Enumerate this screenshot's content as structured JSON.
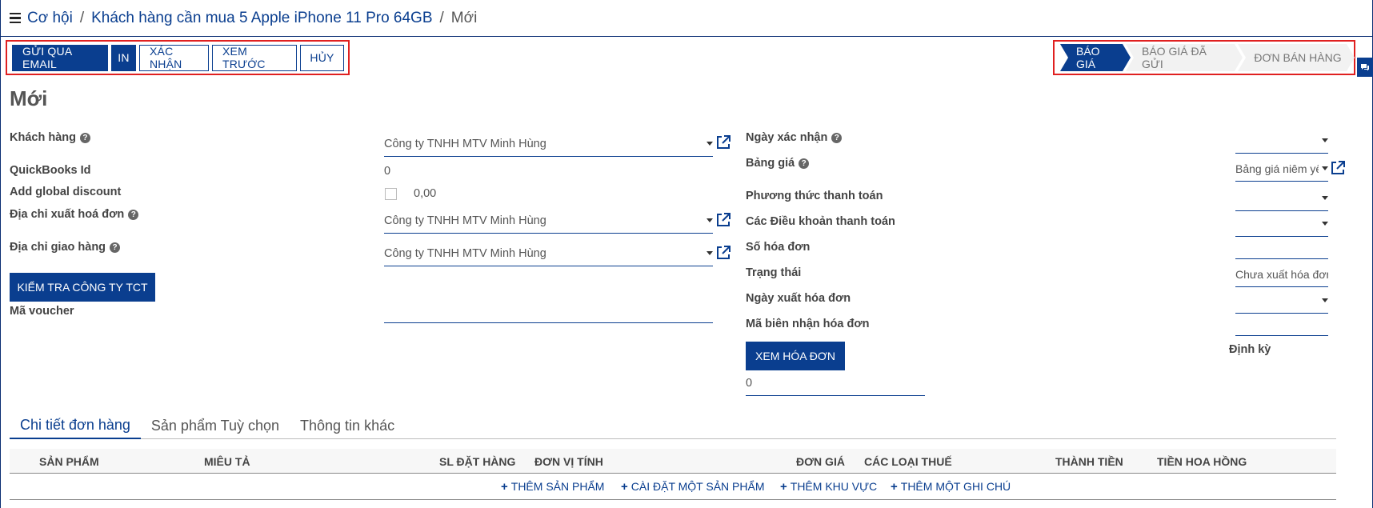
{
  "breadcrumb": {
    "items": [
      "Cơ hội",
      "Khách hàng cần mua 5 Apple iPhone 11 Pro 64GB"
    ],
    "separator": "/",
    "current": "Mới"
  },
  "actions": {
    "send_email": "GỬI QUA EMAIL",
    "print": "IN",
    "confirm": "XÁC NHẬN",
    "preview": "XEM TRƯỚC",
    "cancel": "HỦY"
  },
  "status_stages": [
    "BÁO GIÁ",
    "BÁO GIÁ ĐÃ GỬI",
    "ĐƠN BÁN HÀNG"
  ],
  "active_stage": "BÁO GIÁ",
  "record_title": "Mới",
  "left_fields": {
    "customer": {
      "label": "Khách hàng",
      "value": "Công ty TNHH MTV Minh Hùng"
    },
    "quickbooks": {
      "label": "QuickBooks Id",
      "value": "0"
    },
    "discount": {
      "label": "Add global discount",
      "value": "0,00"
    },
    "invoice_address": {
      "label": "Địa chỉ xuất hoá đơn",
      "value": "Công ty TNHH MTV Minh Hùng"
    },
    "delivery_address": {
      "label": "Địa chỉ giao hàng",
      "value": "Công ty TNHH MTV Minh Hùng"
    },
    "check_company_button": "KIỂM TRA CÔNG TY TCT",
    "voucher": {
      "label": "Mã voucher",
      "value": ""
    }
  },
  "right_fields": {
    "confirm_date": {
      "label": "Ngày xác nhận"
    },
    "pricelist": {
      "label": "Bảng giá",
      "value": "Bảng giá niêm yết"
    },
    "payment_method": {
      "label": "Phương thức thanh toán"
    },
    "payment_terms": {
      "label": "Các Điều khoản thanh toán"
    },
    "invoice_number": {
      "label": "Số hóa đơn"
    },
    "status": {
      "label": "Trạng thái",
      "value": "Chưa xuất hóa đơn"
    },
    "invoice_date": {
      "label": "Ngày xuất hóa đơn"
    },
    "invoice_receipt_code": {
      "label": "Mã biên nhận hóa đơn"
    },
    "view_invoice_button": "XEM HÓA ĐƠN",
    "invoice_count": "0",
    "recurring_label": "Định kỳ"
  },
  "tabs": [
    "Chi tiết đơn hàng",
    "Sản phẩm Tuỳ chọn",
    "Thông tin khác"
  ],
  "active_tab": "Chi tiết đơn hàng",
  "table": {
    "columns": [
      "SẢN PHẨM",
      "MIÊU TẢ",
      "SL ĐẶT HÀNG",
      "ĐƠN VỊ TÍNH",
      "ĐƠN GIÁ",
      "CÁC LOẠI THUẾ",
      "THÀNH TIỀN",
      "TIỀN HOA HỒNG"
    ],
    "add_links": [
      "THÊM SẢN PHẨM",
      "CÀI ĐẶT MỘT SẢN PHẨM",
      "THÊM KHU VỰC",
      "THÊM MỘT GHI CHÚ"
    ]
  },
  "colors": {
    "primary": "#0a3e8f",
    "highlight_border": "#e02020"
  }
}
